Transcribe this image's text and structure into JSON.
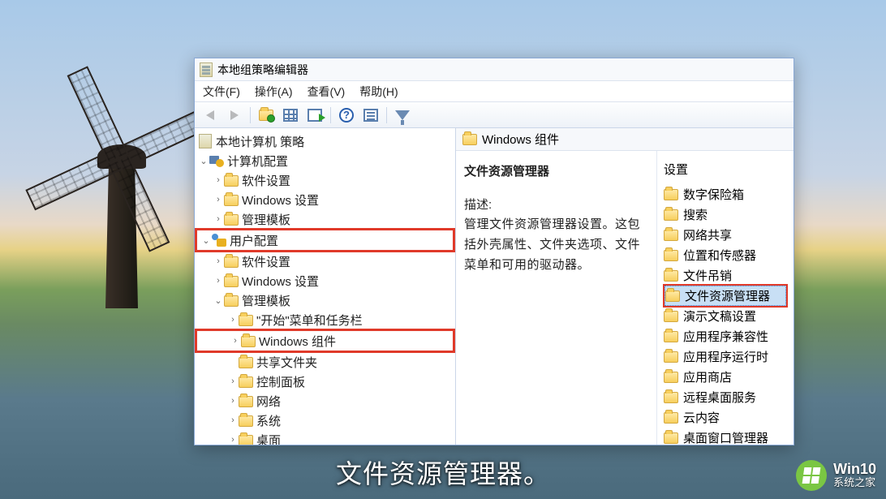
{
  "window": {
    "title": "本地组策略编辑器"
  },
  "menubar": {
    "file": "文件(F)",
    "action": "操作(A)",
    "view": "查看(V)",
    "help": "帮助(H)"
  },
  "tree": {
    "root": "本地计算机 策略",
    "computer_config": "计算机配置",
    "user_config": "用户配置",
    "software_settings": "软件设置",
    "windows_settings": "Windows 设置",
    "admin_templates": "管理模板",
    "start_taskbar": "\"开始\"菜单和任务栏",
    "windows_components": "Windows 组件",
    "shared_folders": "共享文件夹",
    "control_panel": "控制面板",
    "network": "网络",
    "system": "系统",
    "desktop": "桌面"
  },
  "right": {
    "header": "Windows 组件",
    "desc_title": "文件资源管理器",
    "desc_label": "描述:",
    "desc_text": "管理文件资源管理器设置。这包括外壳属性、文件夹选项、文件菜单和可用的驱动器。",
    "settings_heading": "设置",
    "items": {
      "digital_locker": "数字保险箱",
      "search": "搜索",
      "network_sharing": "网络共享",
      "location_sensors": "位置和传感器",
      "file_revocation": "文件吊销",
      "file_explorer": "文件资源管理器",
      "presentation": "演示文稿设置",
      "app_compat": "应用程序兼容性",
      "app_runtime": "应用程序运行时",
      "app_store": "应用商店",
      "remote_desktop": "远程桌面服务",
      "cloud_content": "云内容",
      "window_mgr": "桌面窗口管理器"
    }
  },
  "caption": "文件资源管理器。",
  "watermark": {
    "line1": "Win10",
    "line2": "系统之家"
  }
}
